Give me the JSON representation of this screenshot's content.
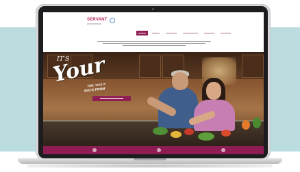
{
  "brand": {
    "name": "SERVANT",
    "subtitle": "ENTERPRISES",
    "accent_color": "#8e1d53"
  },
  "hero": {
    "script_small": "IT'S",
    "script_large": "Your",
    "tagline_1": "TIME. TAKE IT",
    "tagline_2": "BACK FROM"
  }
}
